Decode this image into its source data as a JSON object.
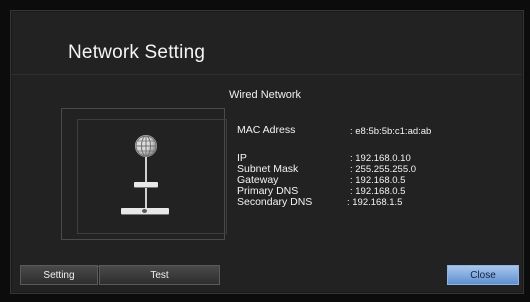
{
  "window": {
    "title": "Network Setting",
    "subtitle": "Wired Network"
  },
  "info": {
    "mac": {
      "label": "MAC Adress",
      "value": ": e8:5b:5b:c1:ad:ab"
    },
    "ip": {
      "label": "IP",
      "value": ": 192.168.0.10"
    },
    "subnet": {
      "label": "Subnet Mask",
      "value": ": 255.255.255.0"
    },
    "gateway": {
      "label": "Gateway",
      "value": ": 192.168.0.5"
    },
    "primary_dns": {
      "label": "Primary DNS",
      "value": ": 192.168.0.5"
    },
    "secondary_dns": {
      "label": "Secondary DNS",
      "value": ": 192.168.1.5"
    }
  },
  "buttons": {
    "setting": "Setting",
    "test": "Test",
    "close": "Close"
  },
  "icons": [
    "globe-icon",
    "network-device-icon",
    "router-icon"
  ],
  "colors": {
    "accent": "#7aa6de",
    "background": "#222222"
  }
}
